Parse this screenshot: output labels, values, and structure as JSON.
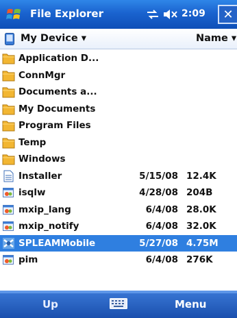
{
  "titlebar": {
    "title": "File Explorer",
    "time": "2:09",
    "close_label": "✕",
    "icons": [
      "windows-start-logo",
      "connectivity-icon",
      "volume-icon"
    ],
    "colors": {
      "bar": "#1a63cf",
      "text": "#ffffff"
    }
  },
  "header": {
    "folder": "My Device ▾",
    "sort": "Name ▾"
  },
  "files": [
    {
      "name": "Application D...",
      "date": "",
      "size": "",
      "icon": "folder"
    },
    {
      "name": "ConnMgr",
      "date": "",
      "size": "",
      "icon": "folder"
    },
    {
      "name": "Documents a...",
      "date": "",
      "size": "",
      "icon": "folder"
    },
    {
      "name": "My Documents",
      "date": "",
      "size": "",
      "icon": "folder"
    },
    {
      "name": "Program Files",
      "date": "",
      "size": "",
      "icon": "folder"
    },
    {
      "name": "Temp",
      "date": "",
      "size": "",
      "icon": "folder"
    },
    {
      "name": "Windows",
      "date": "",
      "size": "",
      "icon": "folder"
    },
    {
      "name": "Installer",
      "date": "5/15/08",
      "size": "12.4K",
      "icon": "document"
    },
    {
      "name": "isqlw",
      "date": "4/28/08",
      "size": "204B",
      "icon": "program"
    },
    {
      "name": "mxip_lang",
      "date": "6/4/08",
      "size": "28.0K",
      "icon": "program"
    },
    {
      "name": "mxip_notify",
      "date": "6/4/08",
      "size": "32.0K",
      "icon": "program"
    },
    {
      "name": "SPLEAMMobile",
      "date": "5/27/08",
      "size": "4.75M",
      "icon": "app",
      "selected": true
    },
    {
      "name": "pim",
      "date": "6/4/08",
      "size": "276K",
      "icon": "program"
    }
  ],
  "menubar": {
    "left": "Up",
    "right": "Menu",
    "center_icon": "keyboard-icon"
  },
  "colors": {
    "selection": "#2f7fe0",
    "menubar": "#1a4fae"
  }
}
